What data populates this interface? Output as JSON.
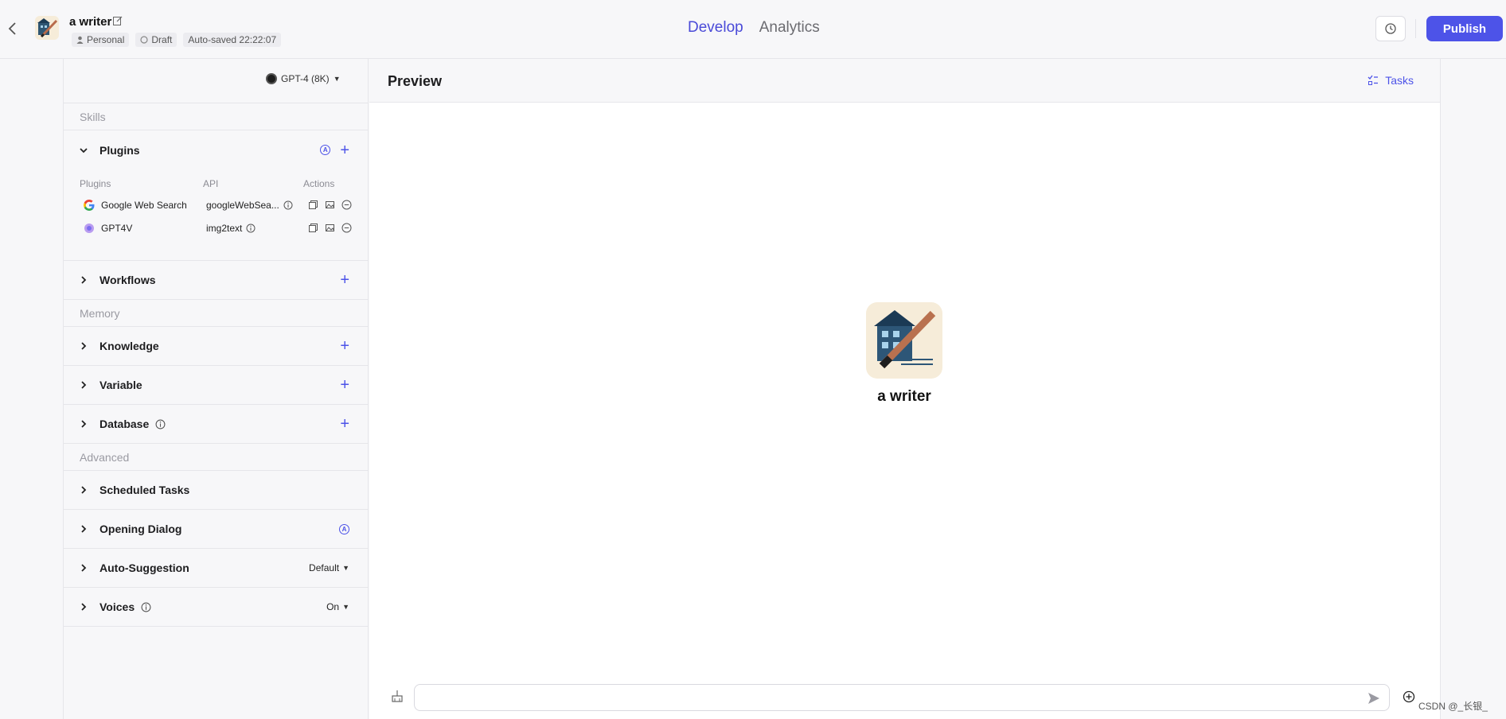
{
  "header": {
    "app_name": "a writer",
    "chips": {
      "personal": "Personal",
      "draft": "Draft",
      "autosave": "Auto-saved 22:22:07"
    },
    "tabs": [
      {
        "label": "Develop",
        "active": true
      },
      {
        "label": "Analytics",
        "active": false
      }
    ],
    "publish_label": "Publish",
    "accent": "#4d53e8"
  },
  "config": {
    "model": "GPT-4 (8K)",
    "sections": {
      "skills": "Skills",
      "memory": "Memory",
      "advanced": "Advanced"
    },
    "plugins": {
      "label": "Plugins",
      "columns": {
        "name": "Plugins",
        "api": "API",
        "actions": "Actions"
      },
      "rows": [
        {
          "name": "Google Web Search",
          "api": "googleWebSea...",
          "logo": "google-icon"
        },
        {
          "name": "GPT4V",
          "api": "img2text",
          "logo": "gpt4v-icon"
        }
      ]
    },
    "workflows": "Workflows",
    "knowledge": "Knowledge",
    "variable": "Variable",
    "database": "Database",
    "scheduled_tasks": "Scheduled Tasks",
    "opening_dialog": "Opening Dialog",
    "auto_suggestion": {
      "label": "Auto-Suggestion",
      "value": "Default"
    },
    "voices": {
      "label": "Voices",
      "value": "On"
    }
  },
  "preview": {
    "title": "Preview",
    "tasks_label": "Tasks",
    "bot_name": "a writer",
    "input_placeholder": ""
  },
  "watermark": "CSDN @_长银_"
}
